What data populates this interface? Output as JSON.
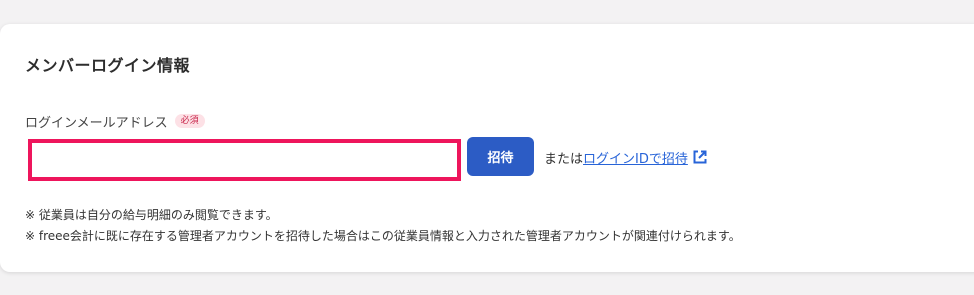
{
  "section": {
    "title": "メンバーログイン情報"
  },
  "email_field": {
    "label": "ログインメールアドレス",
    "required_badge": "必須",
    "value": "",
    "placeholder": ""
  },
  "invite_button": {
    "label": "招待"
  },
  "alternative": {
    "prefix": "または",
    "link_label": "ログインIDで招待",
    "icon": "external-link-icon"
  },
  "notes": [
    "※ 従業員は自分の給与明細のみ閲覧できます。",
    "※ freee会計に既に存在する管理者アカウントを招待した場合はこの従業員情報と入力された管理者アカウントが関連付けられます。"
  ],
  "colors": {
    "highlight_border": "#ee155c",
    "primary_button": "#2c5cc5",
    "link": "#2864d8",
    "badge_bg": "#fde1e6",
    "badge_text": "#c8254a"
  }
}
